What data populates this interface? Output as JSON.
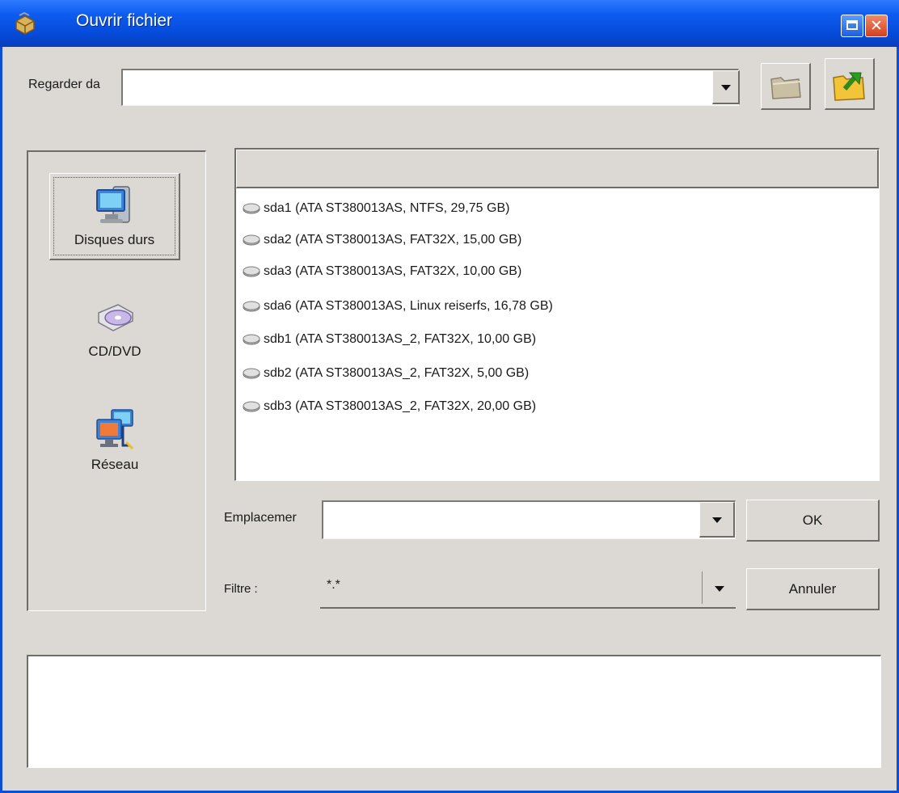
{
  "window": {
    "title": "Ouvrir fichier"
  },
  "icons": {
    "title": "app-icon",
    "maximize": "maximize-icon",
    "close": "close-icon",
    "folder": "folder-icon",
    "up": "folder-up-icon",
    "disk": "disk-icon",
    "harddrive": "hard-drive-icon",
    "cdrom": "cd-dvd-icon",
    "network": "network-icon"
  },
  "colors": {
    "titlebar": "#0649d8",
    "window_bg": "#dcd9d4",
    "close": "#d2401e"
  },
  "lookin": {
    "label": "Regarder da",
    "value": ""
  },
  "places": [
    {
      "label": "Disques durs",
      "selected": true
    },
    {
      "label": "CD/DVD",
      "selected": false
    },
    {
      "label": "Réseau",
      "selected": false
    }
  ],
  "files": [
    "sda1 (ATA ST380013AS, NTFS, 29,75 GB)",
    "sda2 (ATA ST380013AS, FAT32X, 15,00 GB)",
    "sda3 (ATA ST380013AS, FAT32X, 10,00 GB)",
    "sda6 (ATA ST380013AS, Linux reiserfs, 16,78 GB)",
    "sdb1 (ATA ST380013AS_2, FAT32X, 10,00 GB)",
    "sdb2 (ATA ST380013AS_2, FAT32X, 5,00 GB)",
    "sdb3 (ATA ST380013AS_2, FAT32X, 20,00 GB)"
  ],
  "location": {
    "label": "Emplacemer",
    "value": ""
  },
  "filter": {
    "label": "Filtre :",
    "value": "*.*"
  },
  "buttons": {
    "ok": "OK",
    "cancel": "Annuler"
  }
}
